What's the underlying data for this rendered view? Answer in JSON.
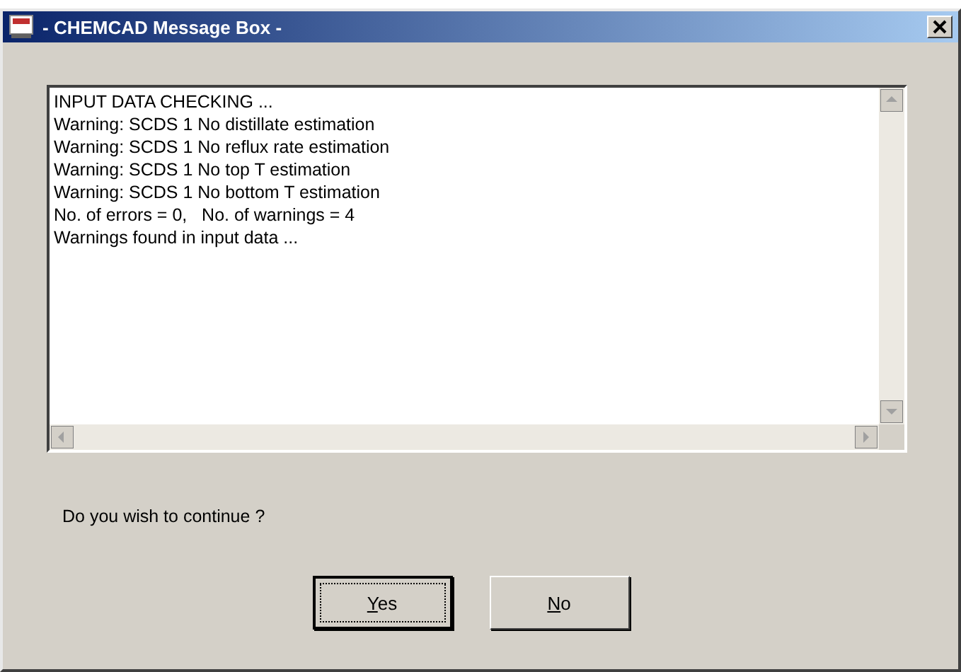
{
  "window": {
    "title": "- CHEMCAD Message Box -"
  },
  "messages": [
    "INPUT DATA CHECKING ...",
    "Warning: SCDS 1 No distillate estimation",
    "Warning: SCDS 1 No reflux rate estimation",
    "Warning: SCDS 1 No top T estimation",
    "Warning: SCDS 1 No bottom T estimation",
    "No. of errors = 0,   No. of warnings = 4",
    "Warnings found in input data ..."
  ],
  "prompt": "Do you wish to continue ?",
  "buttons": [
    {
      "label": "Yes",
      "default": true
    },
    {
      "label": "No",
      "default": false
    }
  ]
}
